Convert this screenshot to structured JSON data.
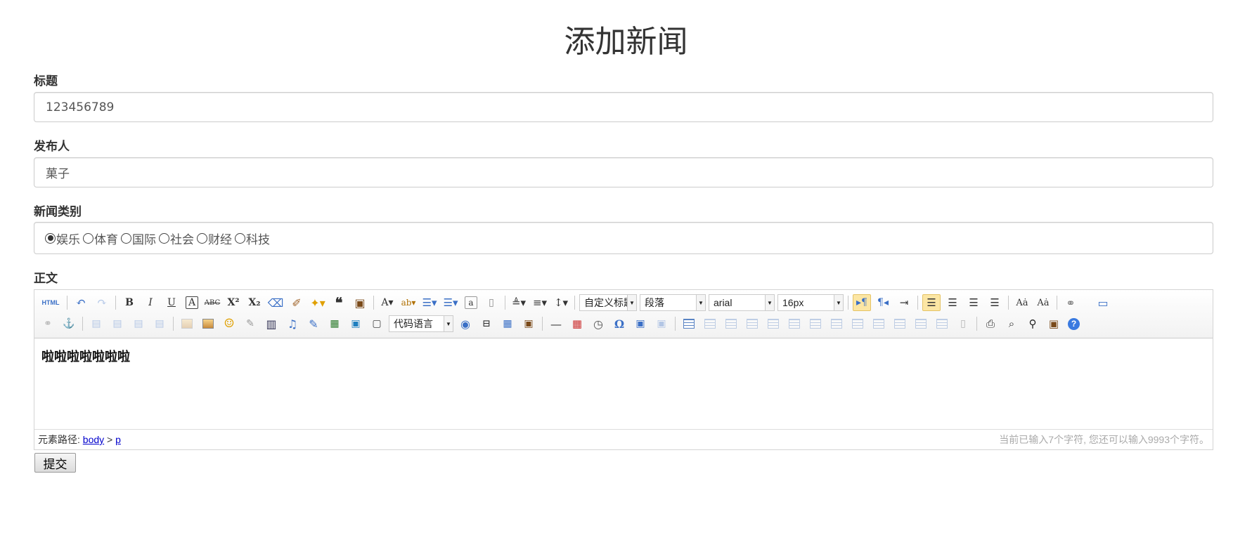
{
  "page": {
    "title": "添加新闻"
  },
  "form": {
    "title_label": "标题",
    "title_value": "123456789",
    "author_label": "发布人",
    "author_value": "菓子",
    "category_label": "新闻类别",
    "categories": [
      {
        "label": "娱乐",
        "checked": true
      },
      {
        "label": "体育",
        "checked": false
      },
      {
        "label": "国际",
        "checked": false
      },
      {
        "label": "社会",
        "checked": false
      },
      {
        "label": "财经",
        "checked": false
      },
      {
        "label": "科技",
        "checked": false
      }
    ],
    "content_label": "正文",
    "submit_label": "提交"
  },
  "editor": {
    "toolbar": {
      "html_label": "HTML",
      "custom_heading": "自定义标题",
      "paragraph_format": "段落",
      "font_family": "arial",
      "font_size": "16px",
      "code_language": "代码语言"
    },
    "content": "啦啦啦啦啦啦啦",
    "status": {
      "path_label": "元素路径:",
      "path_body": "body",
      "path_sep": ">",
      "path_p": "p",
      "char_count": "当前已输入7个字符, 您还可以输入9993个字符。"
    }
  }
}
